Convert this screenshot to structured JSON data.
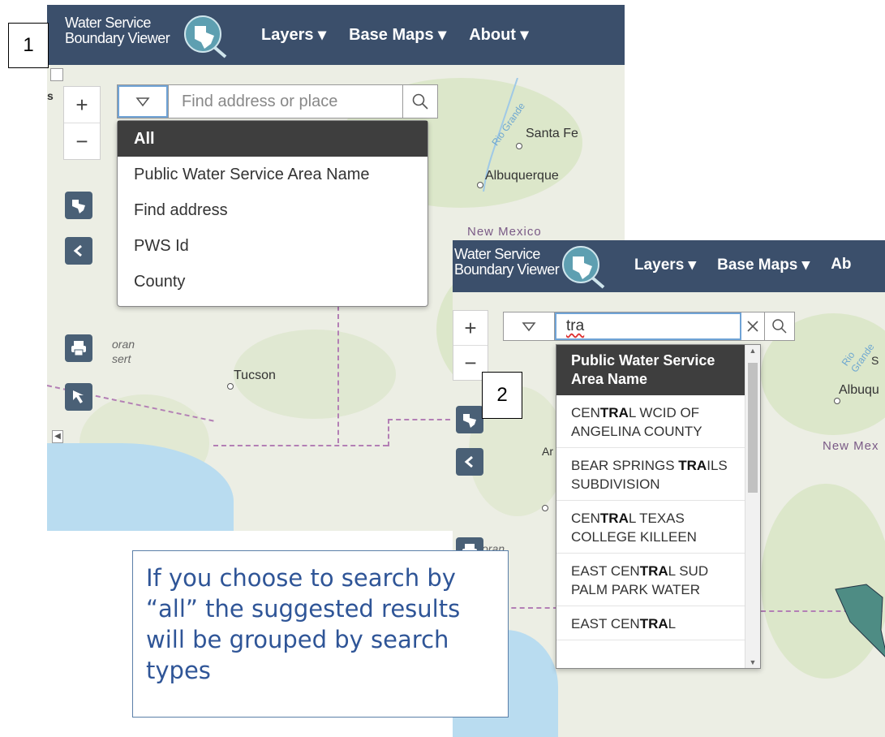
{
  "panel1": {
    "step_number": "1",
    "app": {
      "title_line1": "Water Service",
      "title_line2": "Boundary Viewer"
    },
    "nav": [
      {
        "label": "Layers ▾"
      },
      {
        "label": "Base Maps ▾"
      },
      {
        "label": "About ▾"
      }
    ],
    "zoom": {
      "in": "+",
      "out": "−"
    },
    "search": {
      "placeholder": "Find address or place",
      "value": ""
    },
    "source_menu": {
      "items": [
        {
          "label": "All",
          "selected": true
        },
        {
          "label": "Public Water Service Area Name"
        },
        {
          "label": "Find address"
        },
        {
          "label": "PWS Id"
        },
        {
          "label": "County"
        }
      ]
    },
    "map_labels": {
      "santa_fe": "Santa Fe",
      "albuquerque": "Albuquerque",
      "new_mexico": "New Mexico",
      "tucson": "Tucson",
      "sonoran": "oran",
      "desert": "sert",
      "rio_grande": "Rio Grande",
      "edge_s": "s"
    }
  },
  "panel2": {
    "step_number": "2",
    "app": {
      "title_line1": "Water Service",
      "title_line2": "Boundary Viewer"
    },
    "nav": [
      {
        "label": "Layers ▾"
      },
      {
        "label": "Base Maps ▾"
      },
      {
        "label": "Ab"
      }
    ],
    "zoom": {
      "in": "+",
      "out": "−"
    },
    "search": {
      "value": "tra"
    },
    "suggestions": {
      "group_header": "Public Water Service Area Name",
      "items": [
        {
          "before": "CEN",
          "match": "TRA",
          "after": "L WCID OF ANGELINA COUNTY"
        },
        {
          "before": "BEAR SPRINGS ",
          "match": "TRA",
          "after": "ILS SUBDIVISION"
        },
        {
          "before": "CEN",
          "match": "TRA",
          "after": "L TEXAS COLLEGE KILLEEN"
        },
        {
          "before": "EAST CEN",
          "match": "TRA",
          "after": "L SUD PALM PARK WATER"
        },
        {
          "before": "EAST CEN",
          "match": "TRA",
          "after": "L"
        }
      ]
    },
    "map_labels": {
      "albuquerque": "Albuqu",
      "new_mexico": "New Mex",
      "sonoran": "oran",
      "rio_grande": "Rio Grande",
      "edge_ar": "Ar",
      "edge_s": "S"
    }
  },
  "callout": {
    "text": "If you choose to search by “all” the suggested results will be grouped by search types"
  }
}
